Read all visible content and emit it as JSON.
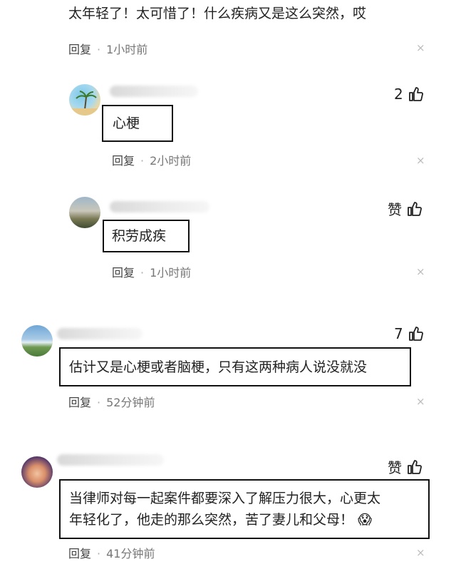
{
  "comments": [
    {
      "text": "太年轻了！太可惜了！什么疾病又是这么突然，哎",
      "reply_label": "回复",
      "time": "1小时前",
      "close": "×"
    },
    {
      "text": "心梗",
      "likes": "2",
      "reply_label": "回复",
      "time": "2小时前",
      "close": "×"
    },
    {
      "text": "积劳成疾",
      "likes": "赞",
      "reply_label": "回复",
      "time": "1小时前",
      "close": "×"
    },
    {
      "text": "估计又是心梗或者脑梗，只有这两种病人说没就没",
      "likes": "7",
      "reply_label": "回复",
      "time": "52分钟前",
      "close": "×"
    },
    {
      "text_line1": "当律师对每一起案件都要深入了解压力很大，心更太",
      "text_line2": "年轻化了，他走的那么突然，苦了妻儿和父母！",
      "emoji": "😱",
      "likes": "赞",
      "reply_label": "回复",
      "time": "41分钟前",
      "close": "×"
    }
  ],
  "icons": {
    "like": "thumbs-up-icon",
    "close": "close-icon",
    "emoji": "scared-face-emoji"
  },
  "colors": {
    "highlight_border": "#111111",
    "meta_text": "#777777"
  }
}
